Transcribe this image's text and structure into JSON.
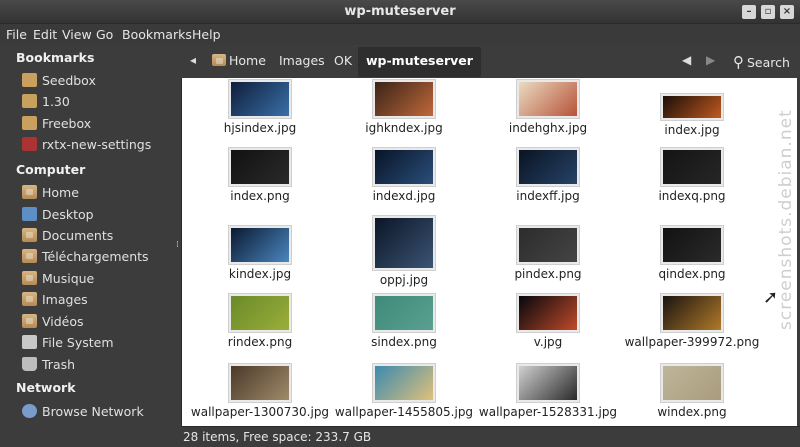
{
  "window": {
    "title": "wp-muteserver"
  },
  "menubar": [
    "File",
    "Edit",
    "View",
    "Go",
    "Bookmarks",
    "Help"
  ],
  "sidebar": {
    "bookmarks_header": "Bookmarks",
    "bookmarks": [
      {
        "label": "Seedbox",
        "icon": "network-folder-icon"
      },
      {
        "label": "1.30",
        "icon": "network-folder-icon"
      },
      {
        "label": "Freebox",
        "icon": "network-folder-icon"
      },
      {
        "label": "rxtx-new-settings",
        "icon": "usb-drive-icon"
      }
    ],
    "computer_header": "Computer",
    "computer": [
      {
        "label": "Home",
        "icon": "home-folder-icon"
      },
      {
        "label": "Desktop",
        "icon": "desktop-icon"
      },
      {
        "label": "Documents",
        "icon": "folder-icon"
      },
      {
        "label": "Téléchargements",
        "icon": "folder-icon"
      },
      {
        "label": "Musique",
        "icon": "folder-icon"
      },
      {
        "label": "Images",
        "icon": "folder-icon"
      },
      {
        "label": "Vidéos",
        "icon": "folder-icon"
      },
      {
        "label": "File System",
        "icon": "drive-icon"
      },
      {
        "label": "Trash",
        "icon": "trash-icon"
      }
    ],
    "network_header": "Network",
    "network": [
      {
        "label": "Browse Network",
        "icon": "network-icon"
      }
    ]
  },
  "pathbar": {
    "crumbs": [
      "Home",
      "Images",
      "OK",
      "wp-muteserver"
    ],
    "search_label": "Search"
  },
  "files": [
    {
      "name": "hjsindex.jpg",
      "colors": [
        "#0e1e3a",
        "#3a6fa8"
      ]
    },
    {
      "name": "ighkndex.jpg",
      "colors": [
        "#3a2418",
        "#c0683a"
      ]
    },
    {
      "name": "indehghx.jpg",
      "colors": [
        "#e8dcc0",
        "#b8523a"
      ]
    },
    {
      "name": "index.jpg",
      "colors": [
        "#1a0e08",
        "#c05a20"
      ]
    },
    {
      "name": "index.png",
      "colors": [
        "#111111",
        "#2a2a2a"
      ]
    },
    {
      "name": "indexd.jpg",
      "colors": [
        "#081426",
        "#2a4e7a"
      ]
    },
    {
      "name": "indexff.jpg",
      "colors": [
        "#0a1424",
        "#264266"
      ]
    },
    {
      "name": "indexq.png",
      "colors": [
        "#141414",
        "#262626"
      ]
    },
    {
      "name": "kindex.jpg",
      "colors": [
        "#0a1a30",
        "#4a86c0"
      ]
    },
    {
      "name": "oppj.jpg",
      "colors": [
        "#0c1626",
        "#3a5474"
      ]
    },
    {
      "name": "pindex.png",
      "colors": [
        "#2c2c2c",
        "#444444"
      ]
    },
    {
      "name": "qindex.png",
      "colors": [
        "#121212",
        "#2a2a2a"
      ]
    },
    {
      "name": "rindex.png",
      "colors": [
        "#6a8a2a",
        "#9aae3a"
      ]
    },
    {
      "name": "sindex.png",
      "colors": [
        "#3e8a7a",
        "#5aa090"
      ]
    },
    {
      "name": "v.jpg",
      "colors": [
        "#05070c",
        "#c04a2a"
      ]
    },
    {
      "name": "wallpaper-399972.png",
      "colors": [
        "#1a1410",
        "#b07a2a"
      ]
    },
    {
      "name": "wallpaper-1300730.jpg",
      "colors": [
        "#4a3a2a",
        "#a08a6a"
      ]
    },
    {
      "name": "wallpaper-1455805.jpg",
      "colors": [
        "#3a8ab0",
        "#e0c07a"
      ]
    },
    {
      "name": "wallpaper-1528331.jpg",
      "colors": [
        "#d0d0d0",
        "#2a2a2a"
      ]
    },
    {
      "name": "windex.png",
      "colors": [
        "#bfb59a",
        "#a89c7c"
      ]
    }
  ],
  "status": "28 items, Free space: 233.7 GB",
  "watermark": "screenshots.debian.net"
}
